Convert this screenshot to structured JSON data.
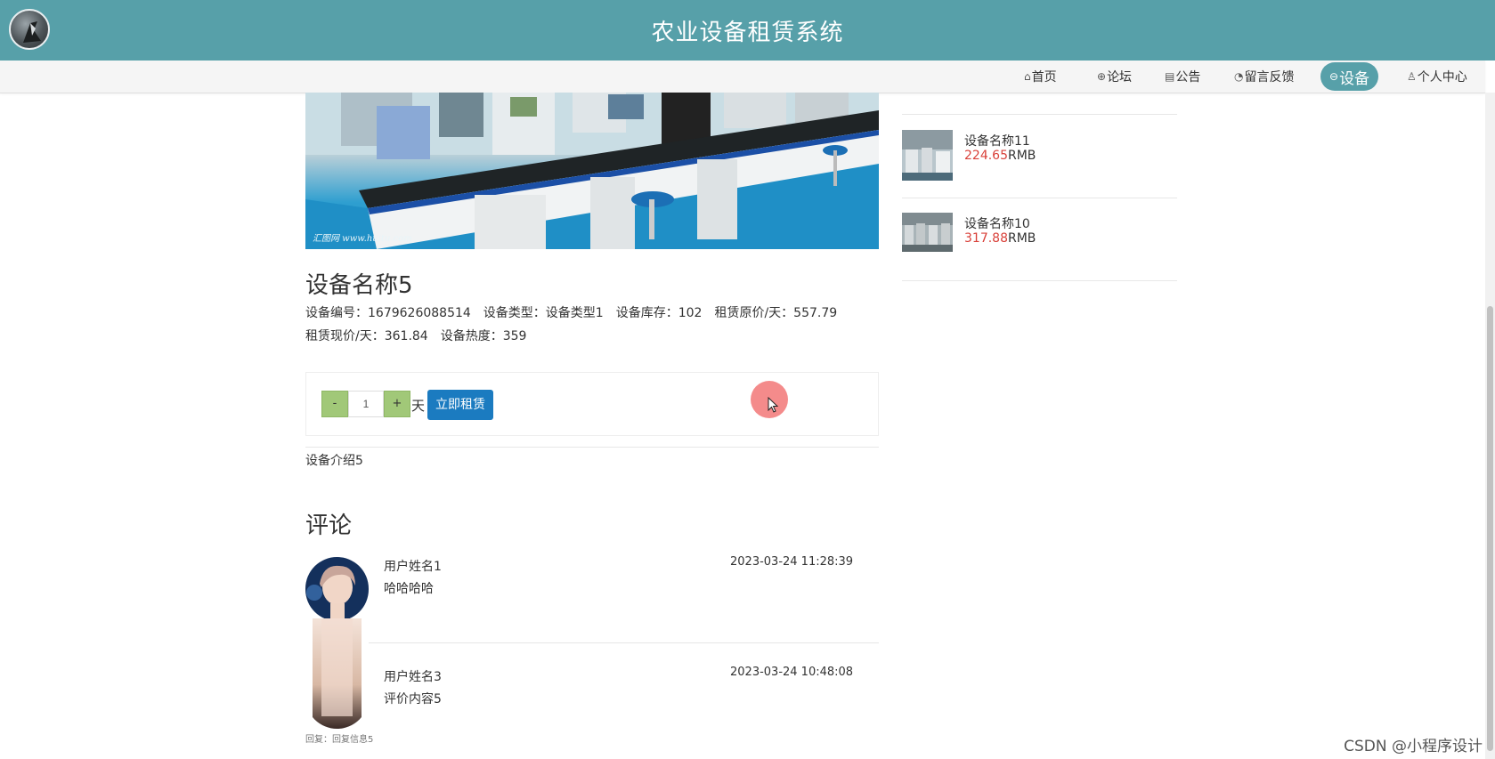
{
  "header": {
    "title": "农业设备租赁系统"
  },
  "nav": {
    "items": [
      {
        "label": "首页",
        "icon": "home-icon"
      },
      {
        "label": "论坛",
        "icon": "globe-icon"
      },
      {
        "label": "公告",
        "icon": "notice-icon"
      },
      {
        "label": "留言反馈",
        "icon": "gauge-icon"
      },
      {
        "label": "设备",
        "icon": "device-icon",
        "active": true
      },
      {
        "label": "个人中心",
        "icon": "user-icon"
      }
    ]
  },
  "product": {
    "image_caption": "汇图网 www.huitu.com",
    "title": "设备名称5",
    "meta_line1": [
      {
        "label": "设备编号：",
        "value": "1679626088514"
      },
      {
        "label": "设备类型：",
        "value": "设备类型1"
      },
      {
        "label": "设备库存：",
        "value": "102"
      },
      {
        "label": "租赁原价/天：",
        "value": "557.79"
      }
    ],
    "meta_line2": [
      {
        "label": "租赁现价/天：",
        "value": "361.84"
      },
      {
        "label": "设备热度：",
        "value": "359"
      }
    ],
    "introduction": "设备介绍5"
  },
  "rent": {
    "minus_label": "-",
    "quantity": "1",
    "plus_label": "+",
    "unit": "天",
    "button_label": "立即租赁"
  },
  "comments": {
    "heading": "评论",
    "items": [
      {
        "user": "用户姓名1",
        "text": "哈哈哈哈",
        "time": "2023-03-24 11:28:39"
      },
      {
        "user": "用户姓名3",
        "text": "评价内容5",
        "time": "2023-03-24 10:48:08",
        "reply": "回复：回复信息5"
      }
    ]
  },
  "sidebar": {
    "items": [
      {
        "name": "设备名称11",
        "price": "224.65",
        "currency": "RMB"
      },
      {
        "name": "设备名称10",
        "price": "317.88",
        "currency": "RMB"
      }
    ]
  },
  "watermark": "CSDN @小程序设计",
  "colors": {
    "header_bg": "#57a0a9",
    "accent_green": "#a1c878",
    "button_blue": "#1b7bc0",
    "price_red": "#d9413a"
  }
}
